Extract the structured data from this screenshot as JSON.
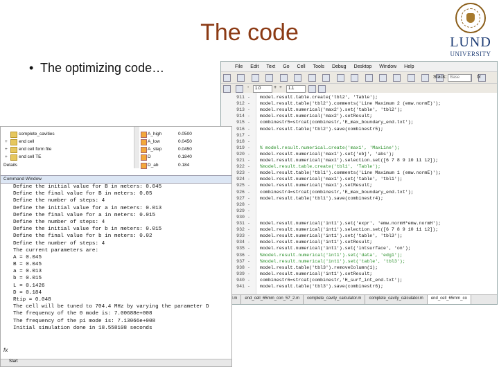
{
  "slide": {
    "title": "The code",
    "bullet": "The optimizing code…",
    "logo": {
      "line1": "LUND",
      "line2": "UNIVERSITY"
    }
  },
  "editor": {
    "menu": [
      "File",
      "Edit",
      "Text",
      "Go",
      "Cell",
      "Tools",
      "Debug",
      "Desktop",
      "Window",
      "Help"
    ],
    "stack_label": "Stack:",
    "stack_value": "Base",
    "fx": "fx",
    "zoom_minus": "-",
    "zoom_value1": "1.0",
    "zoom_plus": "+",
    "zoom_div": "÷",
    "zoom_value2": "1.1",
    "lines": [
      {
        "n": "911",
        "t": "model.result.table.create('tbl2', 'Table');"
      },
      {
        "n": "912",
        "t": "model.result.table('tbl2').comments('Line Maximum 2 (emw.normE)');"
      },
      {
        "n": "913",
        "t": "model.result.numerical('max2').set('table', 'tbl2');"
      },
      {
        "n": "914",
        "t": "model.result.numerical('max2').setResult;"
      },
      {
        "n": "915",
        "t": "combinestr5=strcat(combinestr,'E_max_boundary_end.txt');"
      },
      {
        "n": "916",
        "t": "model.result.table('tbl2').save(combinestr5);"
      },
      {
        "n": "917",
        "t": ""
      },
      {
        "n": "918",
        "t": ""
      },
      {
        "n": "919",
        "t": "% model.result.numerical.create('max1', 'MaxLine');"
      },
      {
        "n": "920",
        "t": "model.result.numerical('max1').set('obj', 'abs');"
      },
      {
        "n": "921",
        "t": "model.result.numerical('max1').selection.set([6 7 8 9 10 11 12]);"
      },
      {
        "n": "922",
        "t": "%model.result.table.create('tbl1', 'Table');"
      },
      {
        "n": "923",
        "t": "model.result.table('tbl1').comments('Line Maximum 1 (emw.normE)');"
      },
      {
        "n": "924",
        "t": "model.result.numerical('max1').set('table', 'tbl1');"
      },
      {
        "n": "925",
        "t": "model.result.numerical('max1').setResult;"
      },
      {
        "n": "926",
        "t": "combinestr4=strcat(combinestr,'E_max_boundary_end.txt');"
      },
      {
        "n": "927",
        "t": "model.result.table('tbl1').save(combinestr4);"
      },
      {
        "n": "928",
        "t": ""
      },
      {
        "n": "929",
        "t": ""
      },
      {
        "n": "930",
        "t": ""
      },
      {
        "n": "931",
        "t": "model.result.numerical('int1').set('expr', 'emw.normH*emw.normH');"
      },
      {
        "n": "932",
        "t": "model.result.numerical('int1').selection.set([6 7 8 9 10 11 12]);"
      },
      {
        "n": "933",
        "t": "model.result.numerical('int1').set('table', 'tbl3');"
      },
      {
        "n": "934",
        "t": "model.result.numerical('int1').setResult;"
      },
      {
        "n": "935",
        "t": "model.result.numerical('int1').set('intsurface', 'on');"
      },
      {
        "n": "936",
        "t": "%model.result.numerical('int1').set('data', 'edg1');"
      },
      {
        "n": "937",
        "t": "%model.result.numerical('int1').set('table', 'tbl3');"
      },
      {
        "n": "938",
        "t": "model.result.table('tbl3').removeColumn(1);"
      },
      {
        "n": "939",
        "t": "model.result.numerical('int1').setResult;"
      },
      {
        "n": "940",
        "t": "combinestr6=strcat(combinestr,'H_surf_int_end.txt');"
      },
      {
        "n": "941",
        "t": "model.result.table('tbl3').save(combinestr6);"
      }
    ],
    "tabs": [
      "mod.m",
      "end_cell_65mm_con_57_2.m",
      "complete_cavity_calculator.m",
      "complete_cavity_calculator.m",
      "end_cell_65mm_co"
    ]
  },
  "workspace": {
    "files": [
      {
        "pm": "",
        "name": "complete_cavities"
      },
      {
        "pm": "+",
        "name": "end cell"
      },
      {
        "pm": "+",
        "name": "end cell form file"
      },
      {
        "pm": "+",
        "name": "end cell TE"
      }
    ],
    "details": "Details",
    "vars": [
      {
        "name": "A_high",
        "value": "0.0500"
      },
      {
        "name": "A_low",
        "value": "0.0450"
      },
      {
        "name": "A_step",
        "value": "0.0450"
      },
      {
        "name": "D",
        "value": "0.1840"
      },
      {
        "name": "D_ab",
        "value": "0.184"
      }
    ]
  },
  "command_window": {
    "title": "Command Window",
    "lines": [
      "Define the initial value for B in meters: 0.045",
      "Define the final value for B in meters: 0.05",
      "Define the number of steps: 4",
      "Define the initial value for a in meters: 0.013",
      "Define the final value for a in meters: 0.015",
      "Define the number of steps: 4",
      "Define the initial value for b in meters: 0.015",
      "Define the final value for b in meters: 0.02",
      "Define the number of steps: 4",
      "The current parameters are:",
      "  A = 0.045",
      "  B = 0.045",
      "  a = 0.013",
      "  b = 0.015",
      "  L = 0.1426",
      "  D = 0.184",
      "  Rtip  = 0.048",
      "The cell will be tuned to 704.4 MHz by varying the parameter D",
      "The frequency of the 0 mode is: 7.00688e+008",
      "The frequency of the pi mode is: 7.13066e+008",
      "Initial simulation done in 18.558108 seconds"
    ],
    "fx": "fx",
    "start": "Start"
  }
}
